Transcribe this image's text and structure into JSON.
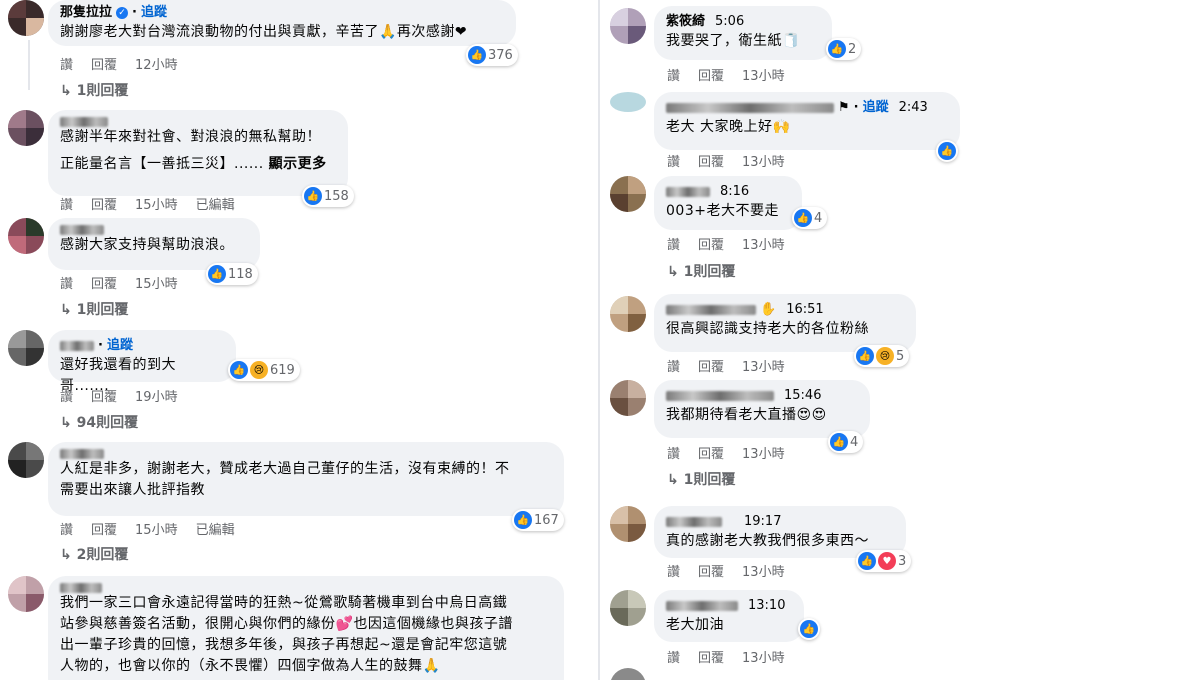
{
  "colors": {
    "like": "#1877f2",
    "bubble": "#f0f2f5",
    "follow": "#0064d1",
    "meta": "#65676b"
  },
  "actions": {
    "like": "讚",
    "reply": "回覆",
    "edited": "已編輯"
  },
  "left": {
    "c1": {
      "name": "那隻拉拉",
      "follow": "追蹤",
      "text": "謝謝廖老大對台灣流浪動物的付出與貢獻，辛苦了🙏再次感謝❤",
      "reactions": "376",
      "time": "12小時",
      "replies": "1則回覆"
    },
    "c2": {
      "text1": "感謝半年來對社會、對浪浪的無私幫助！",
      "text2": "正能量名言【一善抵三災】......",
      "more": "顯示更多",
      "reactions": "158",
      "time": "15小時"
    },
    "c3": {
      "text": "感謝大家支持與幫助浪浪。",
      "reactions": "118",
      "time": "15小時",
      "replies": "1則回覆"
    },
    "c4": {
      "follow": "追蹤",
      "text": "還好我還看的到大哥.......",
      "reactions": "619",
      "time": "19小時",
      "replies": "94則回覆"
    },
    "c5": {
      "text1": "人紅是非多，謝謝老大，贊成老大過自己董仔的生活，沒有束縛的！不",
      "text2": "需要出來讓人批評指教",
      "reactions": "167",
      "time": "15小時",
      "replies": "2則回覆"
    },
    "c6": {
      "text1": "我們一家三口會永遠記得當時的狂熱~從鶯歌騎著機車到台中烏日高鐵",
      "text2": "站參與慈善簽名活動，很開心與你們的緣份💕也因這個機緣也與孩子譜",
      "text3": "出一輩子珍貴的回憶，我想多年後，與孩子再想起~還是會記牢您這號",
      "text4": "人物的，也會以你的（永不畏懼）四個字做為人生的鼓舞🙏"
    }
  },
  "right": {
    "r1": {
      "name": "紫筱綺",
      "time": "5:06",
      "text": "我要哭了，衛生紙🧻",
      "reactions": "2",
      "ago": "13小時"
    },
    "r2": {
      "follow": "追蹤",
      "time": "2:43",
      "text": "老大 大家晚上好🙌",
      "ago": "13小時"
    },
    "r3": {
      "time": "8:16",
      "text": "003+老大不要走",
      "reactions": "4",
      "ago": "13小時",
      "replies": "1則回覆"
    },
    "r4": {
      "time": "16:51",
      "text": "很高興認識支持老大的各位粉絲",
      "reactions": "5",
      "ago": "13小時"
    },
    "r5": {
      "time": "15:46",
      "text": "我都期待看老大直播😍😍",
      "reactions": "4",
      "ago": "13小時",
      "replies": "1則回覆"
    },
    "r6": {
      "time": "19:17",
      "text": "真的感謝老大教我們很多東西～",
      "reactions": "3",
      "ago": "13小時"
    },
    "r7": {
      "time": "13:10",
      "text": "老大加油",
      "ago": "13小時"
    }
  }
}
